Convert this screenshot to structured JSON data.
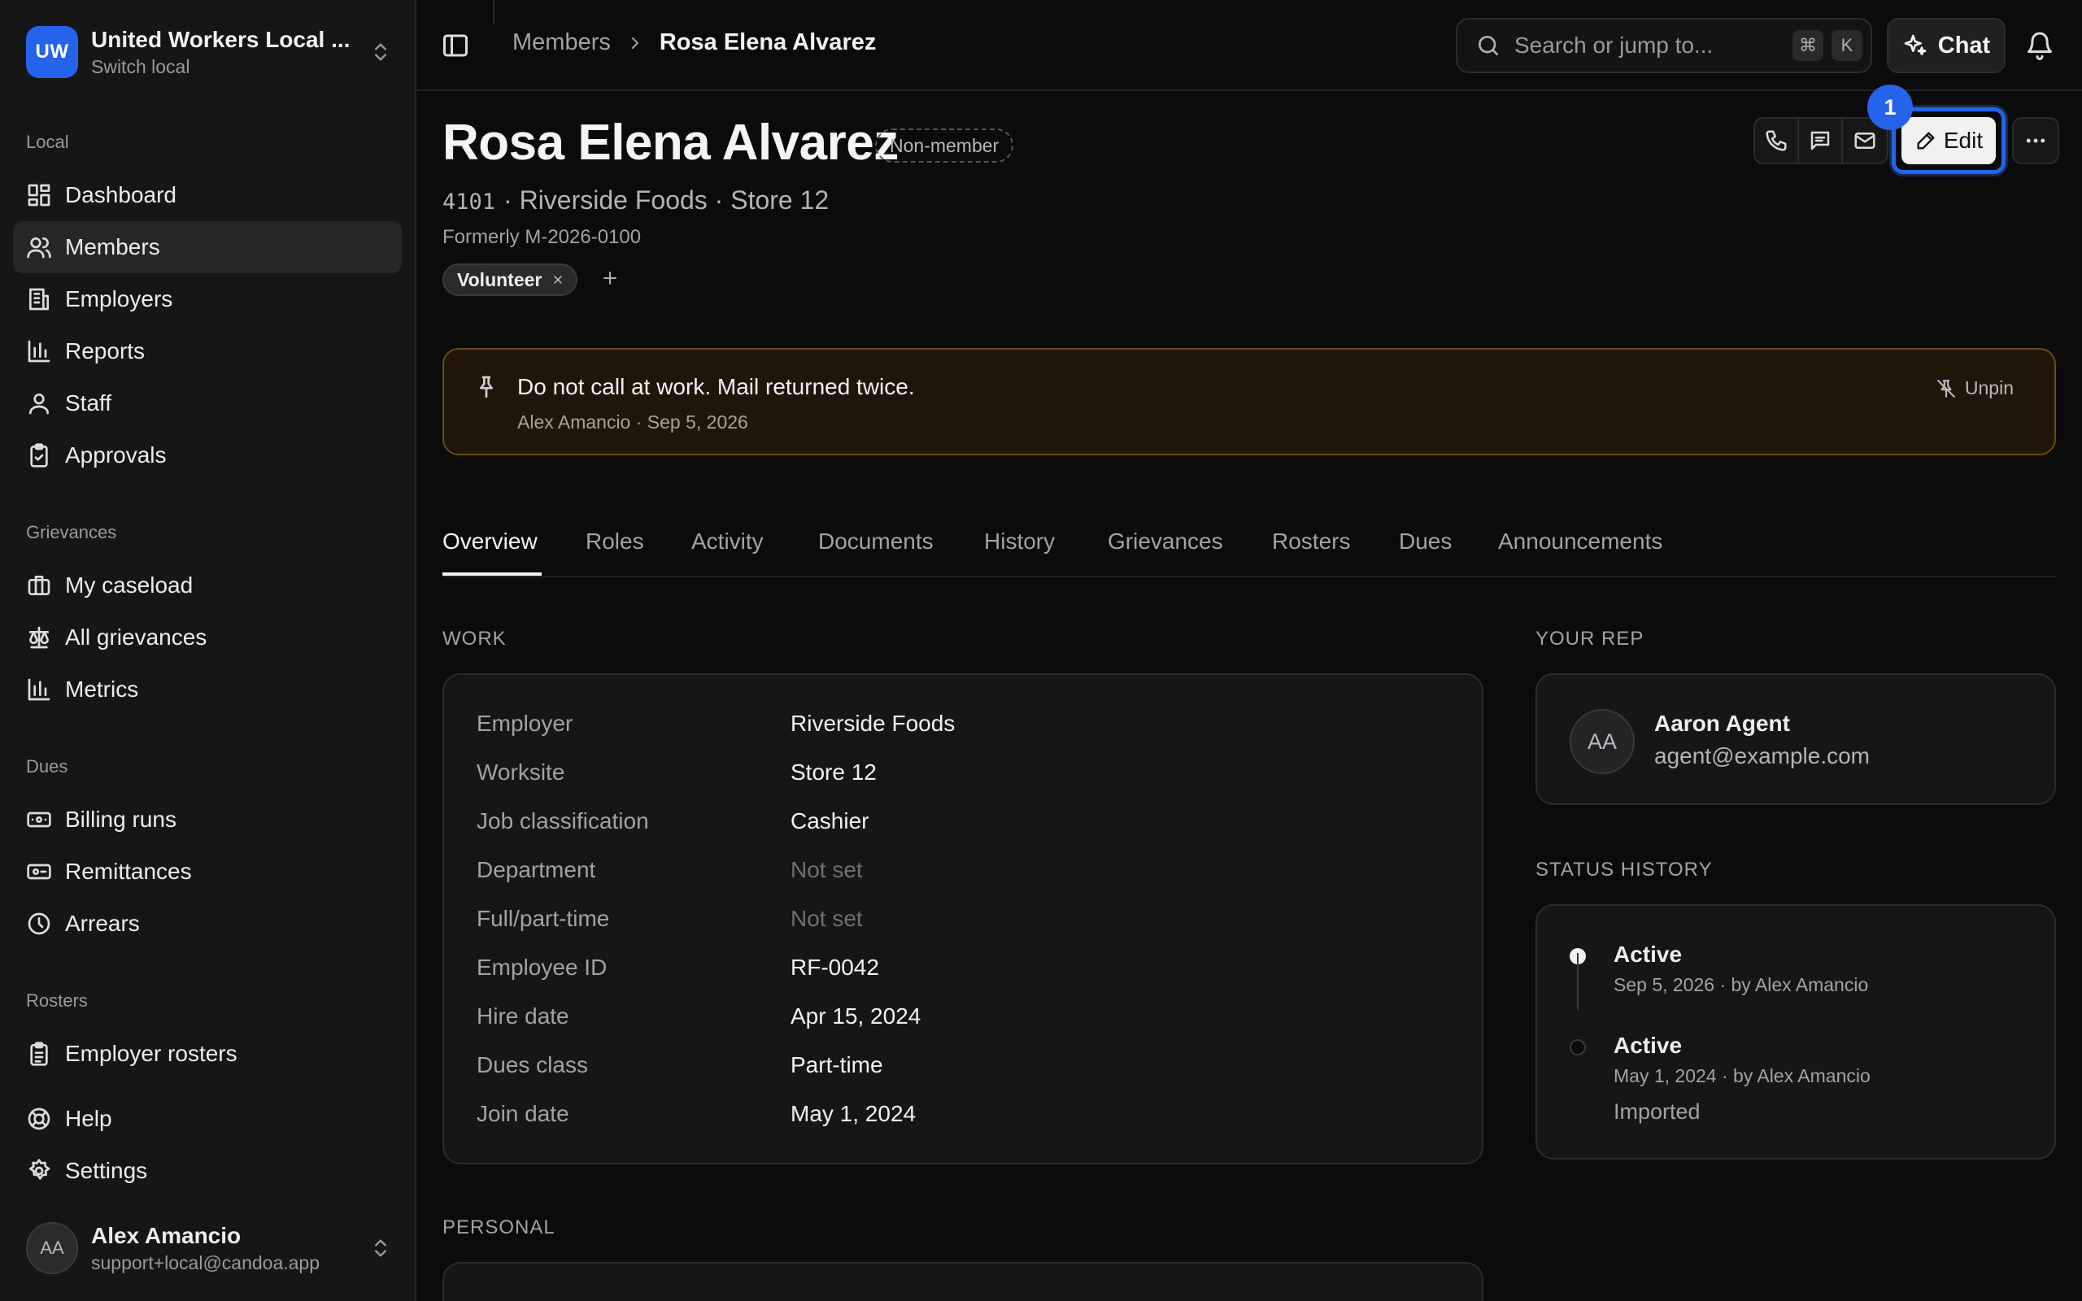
{
  "app": {
    "local_badge": "UW",
    "local_name": "United Workers Local ...",
    "local_sub": "Switch local"
  },
  "sidebar": {
    "sections": {
      "local": "Local",
      "grievances": "Grievances",
      "dues": "Dues",
      "rosters": "Rosters"
    },
    "items": {
      "dashboard": "Dashboard",
      "members": "Members",
      "employers": "Employers",
      "reports": "Reports",
      "staff": "Staff",
      "approvals": "Approvals",
      "my_caseload": "My caseload",
      "all_grievances": "All grievances",
      "metrics": "Metrics",
      "billing_runs": "Billing runs",
      "remittances": "Remittances",
      "arrears": "Arrears",
      "employer_rosters": "Employer rosters",
      "help": "Help",
      "settings": "Settings"
    },
    "user": {
      "initials": "AA",
      "name": "Alex Amancio",
      "email": "support+local@candoa.app"
    }
  },
  "topbar": {
    "breadcrumb_parent": "Members",
    "breadcrumb_current": "Rosa Elena Alvarez",
    "search_placeholder": "Search or jump to...",
    "kbd_cmd": "⌘",
    "kbd_k": "K",
    "chat_label": "Chat"
  },
  "member": {
    "name": "Rosa Elena Alvarez",
    "status": "Non-member",
    "id": "4101",
    "employer_line": "· Riverside Foods · Store 12",
    "formerly": "Formerly M-2026-0100",
    "tag": "Volunteer",
    "edit_label": "Edit",
    "marker": "1"
  },
  "pinned_note": {
    "text": "Do not call at work. Mail returned twice.",
    "meta": "Alex Amancio · Sep 5, 2026",
    "unpin_label": "Unpin"
  },
  "tabs": [
    "Overview",
    "Roles",
    "Activity",
    "Documents",
    "History",
    "Grievances",
    "Rosters",
    "Dues",
    "Announcements"
  ],
  "work": {
    "label": "WORK",
    "fields": [
      {
        "key": "Employer",
        "value": "Riverside Foods"
      },
      {
        "key": "Worksite",
        "value": "Store 12"
      },
      {
        "key": "Job classification",
        "value": "Cashier"
      },
      {
        "key": "Department",
        "value": "Not set"
      },
      {
        "key": "Full/part-time",
        "value": "Not set"
      },
      {
        "key": "Employee ID",
        "value": "RF-0042"
      },
      {
        "key": "Hire date",
        "value": "Apr 15, 2024"
      },
      {
        "key": "Dues class",
        "value": "Part-time"
      },
      {
        "key": "Join date",
        "value": "May 1, 2024"
      }
    ]
  },
  "rep": {
    "label": "YOUR REP",
    "initials": "AA",
    "name": "Aaron Agent",
    "email": "agent@example.com"
  },
  "status_history": {
    "label": "STATUS HISTORY",
    "entries": [
      {
        "status": "Active",
        "meta": "Sep 5, 2026 · by Alex Amancio",
        "note": ""
      },
      {
        "status": "Active",
        "meta": "May 1, 2024 · by Alex Amancio",
        "note": "Imported"
      }
    ]
  },
  "personal": {
    "label": "PERSONAL"
  },
  "colors": {
    "accent": "#2563eb",
    "pinned_bg": "#1f1609",
    "pinned_border": "#6b4a12"
  }
}
